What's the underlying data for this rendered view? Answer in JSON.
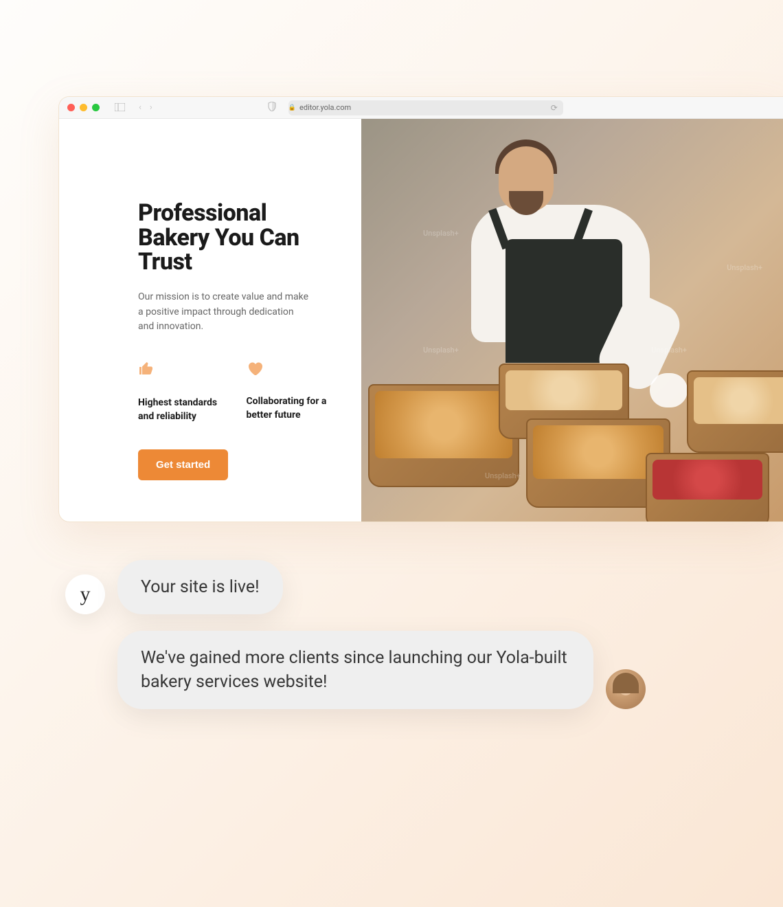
{
  "browser": {
    "url_text": "editor.yola.com"
  },
  "hero": {
    "title": "Professional Bakery You Can Trust",
    "subtitle": "Our mission is to create value and make a positive impact through dedication and innovation.",
    "features": [
      {
        "icon": "thumbs-up-icon",
        "text": "Highest standards and reliability"
      },
      {
        "icon": "heart-icon",
        "text": "Collaborating for a better future"
      }
    ],
    "cta_label": "Get started"
  },
  "image": {
    "watermark": "Unsplash+"
  },
  "chat": {
    "brand_avatar_letter": "y",
    "messages": [
      {
        "text": "Your site is live!"
      },
      {
        "text": "We've gained more clients since launching our Yola-built bakery services website!"
      }
    ]
  }
}
